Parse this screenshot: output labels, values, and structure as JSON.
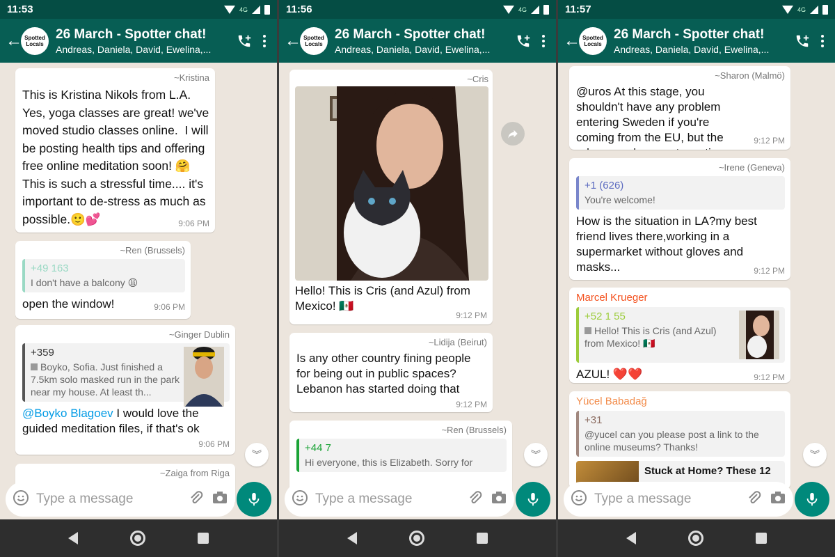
{
  "colors": {
    "header": "#075e54",
    "chat_bg": "#ece5dd",
    "accent": "#00897b",
    "mention": "#039be5"
  },
  "panels": [
    {
      "status_time": "11:53",
      "header": {
        "title": "26 March - Spotter chat!",
        "subtitle": "Andreas, Daniela, David, Ewelina,...",
        "avatar": "Spotted Locals"
      },
      "messages": [
        {
          "sender": "~Kristina",
          "text": "This is Kristina Nikols from L.A. Yes, yoga classes are great! we've moved studio classes online.  I will be posting health tips and offering free online meditation soon! 🤗 This is such a stressful time.... it's important to de-stress as much as possible.🙂💕",
          "time": "9:06 PM"
        },
        {
          "sender": "~Ren (Brussels)",
          "quote_num": "+49 163",
          "quote_text": "I don't have a balcony 😩",
          "text": "open the window!",
          "time": "9:06 PM"
        },
        {
          "sender": "~Ginger Dublin",
          "quote_num": "+359",
          "quote_text": "Boyko, Sofia. Just finished a 7.5km solo masked run in the park near my house. At least th...",
          "mention": "@Boyko Blagoev",
          "text": " I would love the guided meditation files, if that's ok",
          "time": "9:06 PM"
        },
        {
          "sender": "~Zaiga from Riga"
        }
      ],
      "input_placeholder": "Type a message"
    },
    {
      "status_time": "11:56",
      "header": {
        "title": "26 March - Spotter chat!",
        "subtitle": "Andreas, Daniela, David, Ewelina,...",
        "avatar": "Spotted Locals"
      },
      "messages": [
        {
          "sender": "~Cris",
          "text": "Hello! This is Cris (and Azul) from Mexico! 🇲🇽",
          "time": "9:12 PM"
        },
        {
          "sender": "~Lidija (Beirut)",
          "text": "Is any other country fining people for being out in public spaces? Lebanon has started doing that",
          "time": "9:12 PM"
        },
        {
          "sender": "~Ren (Brussels)",
          "quote_num": "+44 7",
          "quote_text": "Hi everyone, this is Elizabeth. Sorry for"
        }
      ],
      "input_placeholder": "Type a message"
    },
    {
      "status_time": "11:57",
      "header": {
        "title": "26 March - Spotter chat!",
        "subtitle": "Andreas, Daniela, David, Ewelina,...",
        "avatar": "Spotted Locals"
      },
      "messages": [
        {
          "sender": "~Sharon (Malmö)",
          "text": "@uros At this stage, you shouldn't have any problem entering Sweden if you're coming from the EU, but the rules can change at any time.",
          "time": "9:12 PM"
        },
        {
          "sender": "~Irene (Geneva)",
          "quote_num": "+1 (626)",
          "quote_text": "You're welcome!",
          "text": "How is the situation in LA?my best friend lives there,working in a supermarket without gloves and masks...",
          "time": "9:12 PM"
        },
        {
          "sender": "Marcel Krueger",
          "quote_num": "+52 1 55",
          "quote_text": "Hello! This is Cris (and Azul) from Mexico! 🇲🇽",
          "text": "AZUL! ❤️❤️",
          "time": "9:12 PM"
        },
        {
          "sender": "Yücel Babadağ",
          "quote_num": "+31",
          "quote_text": "@yucel can you please post a link to the online museums? Thanks!",
          "link_title": "Stuck at Home? These 12"
        }
      ],
      "input_placeholder": "Type a message"
    }
  ]
}
